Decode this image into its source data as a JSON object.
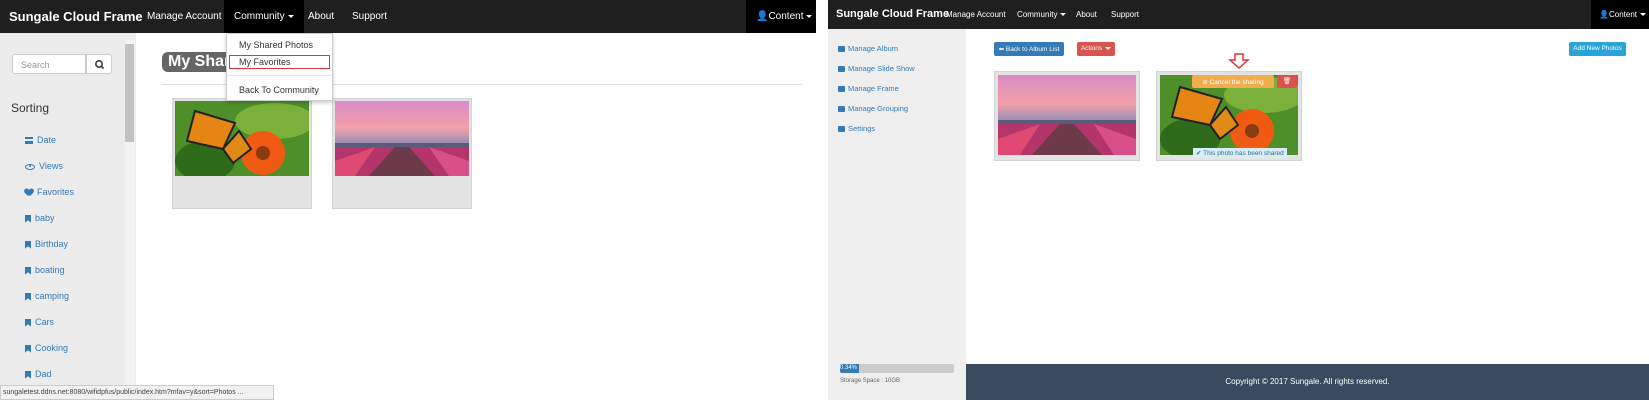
{
  "left": {
    "brand": "Sungale Cloud Frame",
    "nav": [
      "Manage Account",
      "Community",
      "About",
      "Support"
    ],
    "content_menu": "Content",
    "search_placeholder": "Search",
    "sorting_title": "Sorting",
    "sort_items": [
      "Date",
      "Views",
      "Favorites",
      "baby",
      "Birthday",
      "boating",
      "camping",
      "Cars",
      "Cooking",
      "Dad"
    ],
    "page_title": "My Shar",
    "dropdown": [
      "My Shared Photos",
      "My Favorites",
      "Back To Community"
    ],
    "status_url": "sungaletest.ddns.net:8080/wifidpfus/public/index.htm?mfav=y&sort=Photos ..."
  },
  "right": {
    "brand": "Sungale Cloud Frame",
    "nav": [
      "Manage Account",
      "Community",
      "About",
      "Support"
    ],
    "content_menu": "Content",
    "sidebar": [
      "Manage Album",
      "Manage Slide Show",
      "Manage Frame",
      "Manage Grouping",
      "Settings"
    ],
    "back_button": "Back to Album List",
    "actions_button": "Actions",
    "add_button": "Add New Photos",
    "cancel_sharing": "Cancel the sharing",
    "shared_status": "This photo has been shared",
    "progress_label": "0.34%",
    "progress_value": 0.0034,
    "storage": "Storage Space : 10GB",
    "footer": "Copyright © 2017 Sungale. All rights reserved."
  },
  "colors": {
    "accent": "#337ab7",
    "danger": "#d9534f",
    "highlight": "#d9363e",
    "footer": "#3a4a5e"
  }
}
